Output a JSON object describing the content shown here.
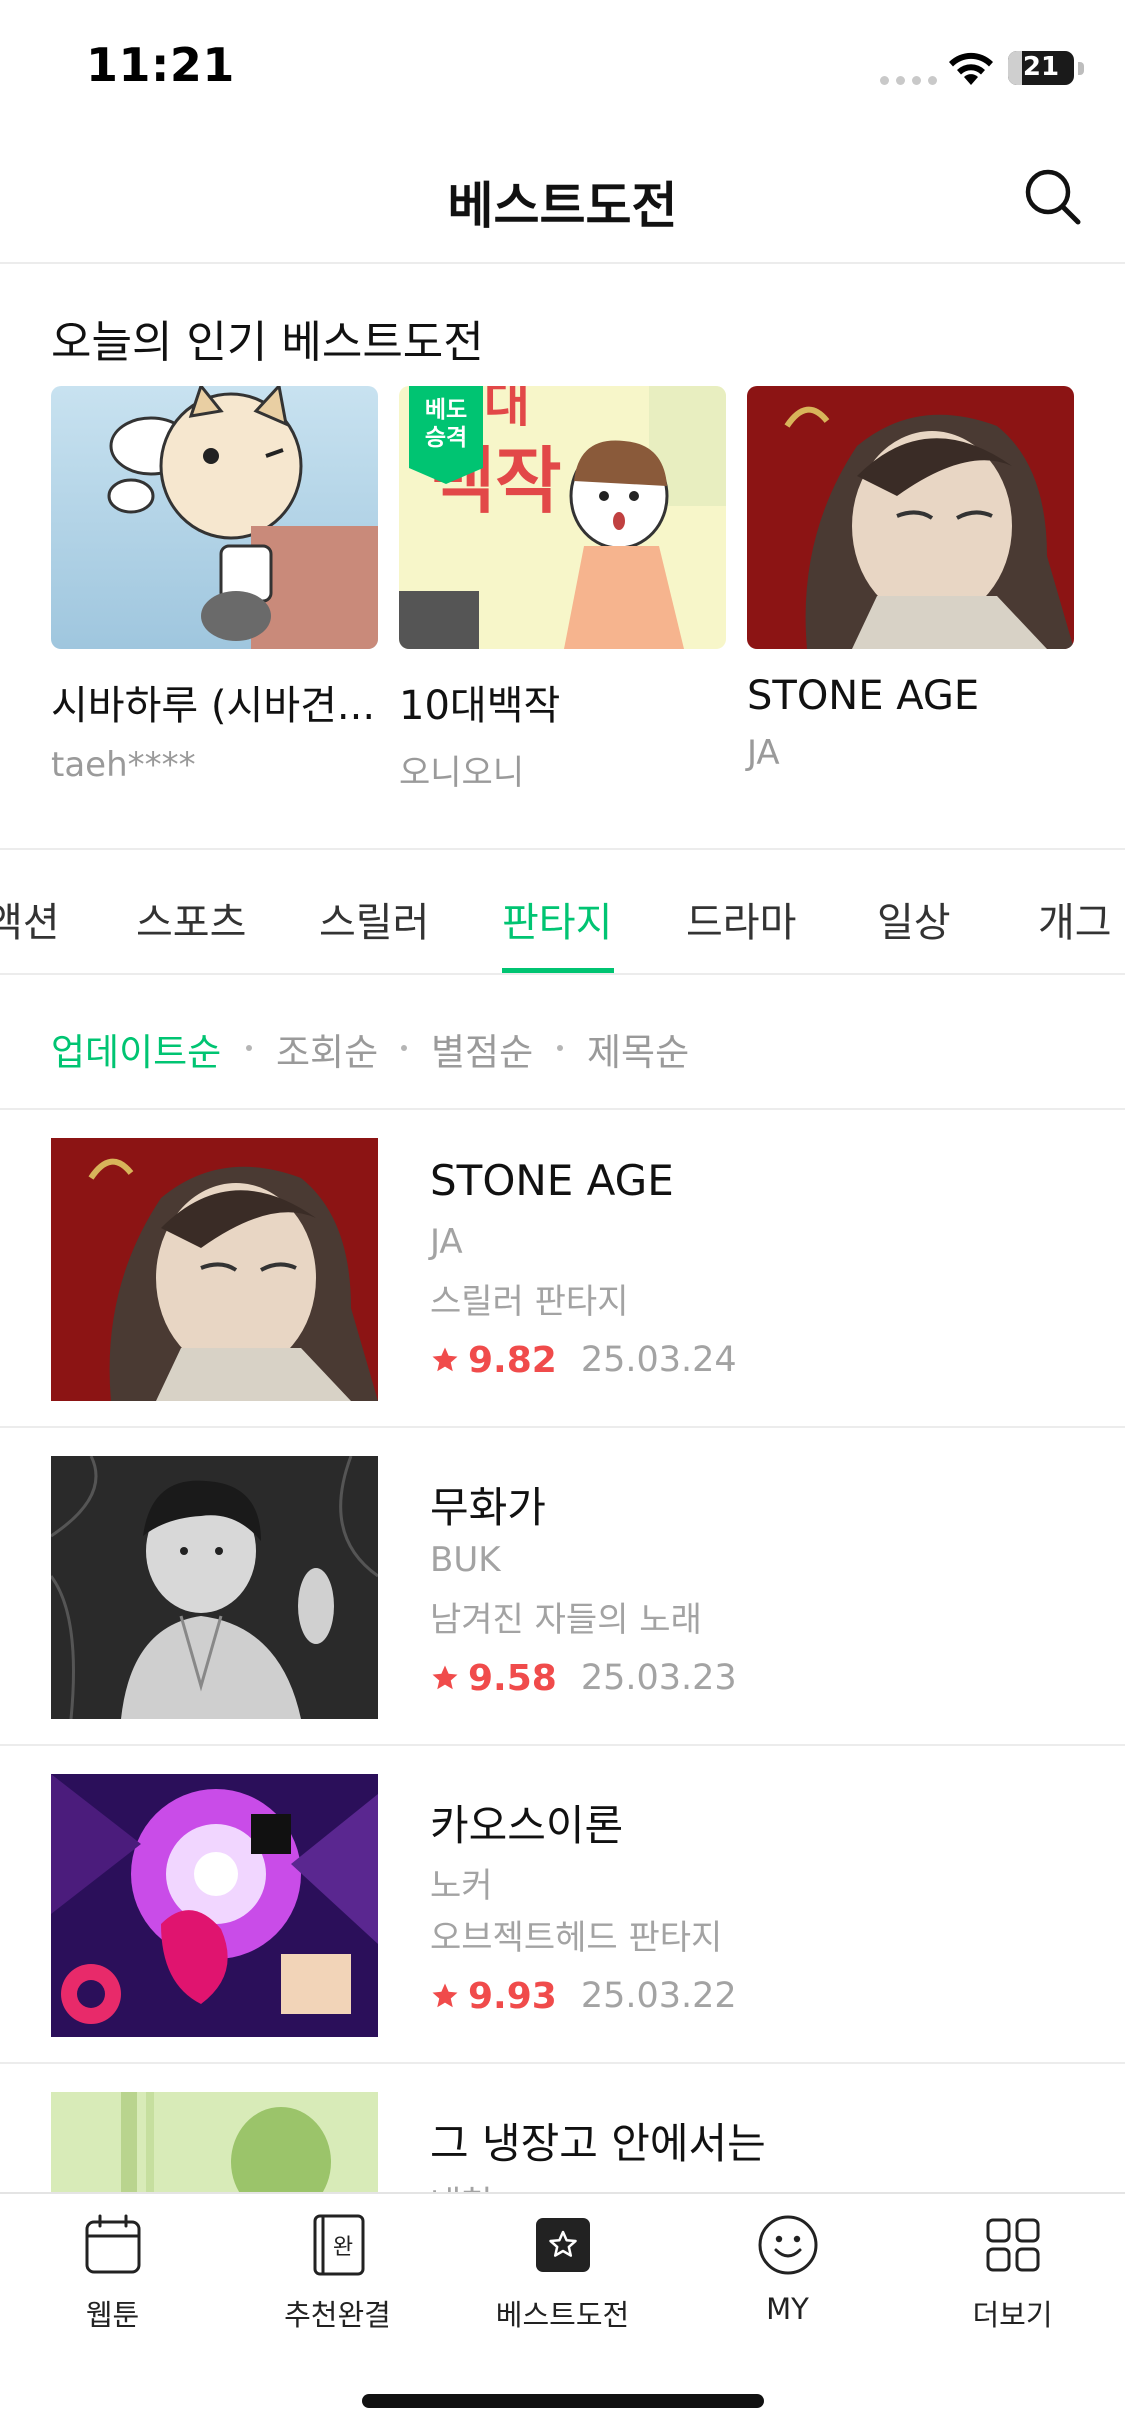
{
  "status_bar": {
    "time": "11:21",
    "battery": "21",
    "battery_level": 0.21
  },
  "header": {
    "title": "베스트도전",
    "search_icon": "search-icon"
  },
  "popular": {
    "title": "오늘의 인기 베스트도전",
    "cards": [
      {
        "title": "시바하루 (시바견...",
        "author": "taeh****"
      },
      {
        "title": "10대백작",
        "author": "오니오니",
        "badge": "베도\n승격"
      },
      {
        "title": "STONE AGE",
        "author": "JA"
      }
    ]
  },
  "genre_tabs": {
    "items": [
      "액션",
      "스포츠",
      "스릴러",
      "판타지",
      "드라마",
      "일상",
      "개그"
    ],
    "active": "판타지"
  },
  "sort": {
    "items": [
      "업데이트순",
      "조회순",
      "별점순",
      "제목순"
    ],
    "active": "업데이트순"
  },
  "list": [
    {
      "title": "STONE AGE",
      "author": "JA",
      "genre": "스릴러 판타지",
      "rating": "9.82",
      "date": "25.03.24"
    },
    {
      "title": "무화가",
      "author": "BUK",
      "genre": "남겨진 자들의 노래",
      "rating": "9.58",
      "date": "25.03.23"
    },
    {
      "title": "카오스이론",
      "author": "노커",
      "genre": "오브젝트헤드 판타지",
      "rating": "9.93",
      "date": "25.03.22"
    },
    {
      "title": "그 냉장고 안에서는",
      "author": "내천",
      "genre": "",
      "rating": "",
      "date": ""
    }
  ],
  "bottom_nav": [
    {
      "label": "웹툰",
      "icon": "calendar-icon"
    },
    {
      "label": "추천완결",
      "icon": "book-complete-icon",
      "icon_text": "완"
    },
    {
      "label": "베스트도전",
      "icon": "star-box-icon",
      "active": true
    },
    {
      "label": "MY",
      "icon": "smile-icon"
    },
    {
      "label": "더보기",
      "icon": "grid-icon"
    }
  ],
  "colors": {
    "accent": "#00c472",
    "rating": "#f04b4b",
    "muted": "#a3a3a3"
  }
}
